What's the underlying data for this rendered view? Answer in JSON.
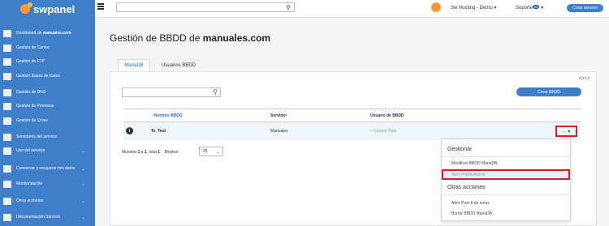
{
  "brand": {
    "name": "swpanel"
  },
  "sidebar": {
    "items": [
      {
        "label_prefix": "Dashboard de ",
        "label_bold": "manuales.com",
        "icon": "dashboard-icon",
        "has_chevron": false
      },
      {
        "label": "Gestión de Correo",
        "icon": "mail-icon",
        "has_chevron": false
      },
      {
        "label": "Gestión de FTP",
        "icon": "ftp-icon",
        "has_chevron": false
      },
      {
        "label": "Gestión Bases de Datos",
        "icon": "database-icon",
        "has_chevron": false
      },
      {
        "label": "Gestión de DNS",
        "icon": "flag-icon",
        "has_chevron": false
      },
      {
        "label": "Gestión de Permisos",
        "icon": "permissions-icon",
        "has_chevron": false
      },
      {
        "label": "Gestión de Crons",
        "icon": "cron-icon",
        "has_chevron": false
      },
      {
        "label": "Servidores del servicio",
        "icon": "server-icon",
        "has_chevron": false
      },
      {
        "label": "Uso del servicio",
        "icon": "usage-icon",
        "has_chevron": true
      },
      {
        "label": "Conservar y recuperar mis datos",
        "icon": "backup-icon",
        "has_chevron": true
      },
      {
        "label": "Monitorización",
        "icon": "monitor-icon",
        "has_chevron": true
      },
      {
        "label": "Otras acciones",
        "icon": "clipboard-icon",
        "has_chevron": true
      },
      {
        "label": "Documentación Servicio",
        "icon": "document-icon",
        "has_chevron": true
      }
    ]
  },
  "topbar": {
    "search_value": "",
    "user_name": "Sw Hosting - Demo",
    "support_label": "Soporte",
    "support_badge": "51",
    "create_service_label": "Crear servicio"
  },
  "main": {
    "title_prefix": "Gestión de BBDD de ",
    "title_domain": "manuales.com",
    "tabs": [
      {
        "label": "MariaDB",
        "active": true
      },
      {
        "label": "Usuarios BBDD",
        "active": false
      }
    ],
    "create_db_label": "Crear BBDD",
    "table": {
      "headers": {
        "name": "Nombre BBDD",
        "server": "Servidor",
        "user": "Usuario de BBDD"
      },
      "rows": [
        {
          "name": "Ts_Test",
          "server": "Manuales",
          "user": "× Control Total"
        }
      ]
    },
    "actions_label": "...",
    "pager": {
      "summary_prefix": "Muestra ",
      "summary_bold1": "1",
      "summary_mid": " a ",
      "summary_bold2": "1",
      "summary_suffix": ". total ",
      "summary_total": "1",
      "show_label": "Mostrar",
      "page_size": "25"
    }
  },
  "dropdown": {
    "heading_manage": "Gestionar",
    "items_manage": [
      "Modificar BBDD MariaDB",
      "Abrir PhpMyAdmin"
    ],
    "heading_other": "Otras acciones",
    "items_other": [
      "Abrir Post-It de notas",
      "Borrar BBDD MariaDB"
    ]
  },
  "colors": {
    "sidebar": "#3f7fc9",
    "accent": "#2c6fc0",
    "highlight_border": "#d81e2a",
    "brand_orange": "#f39c2c"
  }
}
